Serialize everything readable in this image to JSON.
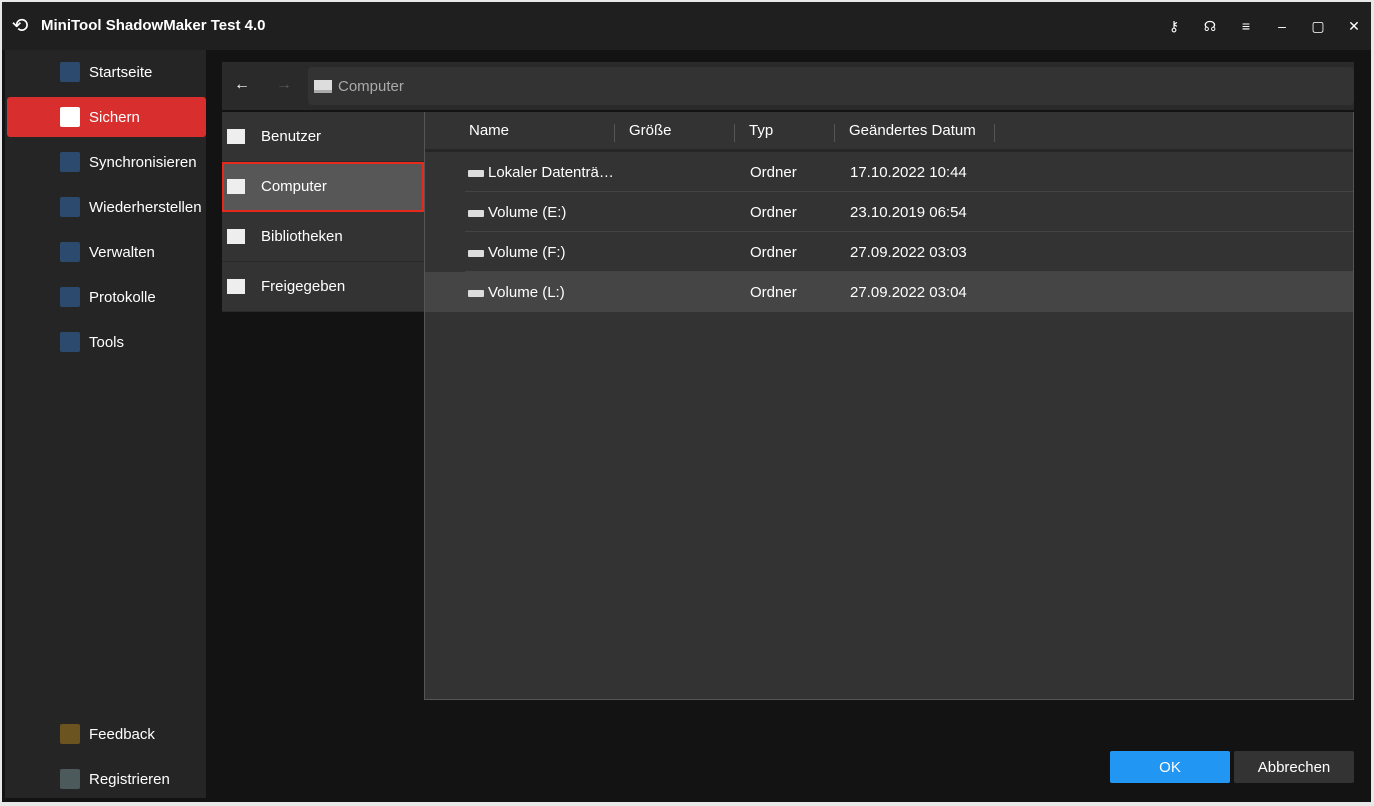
{
  "title": "MiniTool ShadowMaker Test 4.0",
  "sidebar": {
    "items": [
      {
        "label": "Startseite"
      },
      {
        "label": "Sichern"
      },
      {
        "label": "Synchronisieren"
      },
      {
        "label": "Wiederherstellen"
      },
      {
        "label": "Verwalten"
      },
      {
        "label": "Protokolle"
      },
      {
        "label": "Tools"
      }
    ],
    "feedback": "Feedback",
    "register": "Registrieren"
  },
  "nav": {
    "back": "←",
    "forward": "→",
    "path": "Computer"
  },
  "places": [
    {
      "label": "Benutzer"
    },
    {
      "label": "Computer"
    },
    {
      "label": "Bibliotheken"
    },
    {
      "label": "Freigegeben"
    }
  ],
  "columns": {
    "name": "Name",
    "size": "Größe",
    "type": "Typ",
    "date": "Geändertes Datum"
  },
  "rows": [
    {
      "name": "Lokaler Datenträ…",
      "type": "Ordner",
      "date": "17.10.2022 10:44"
    },
    {
      "name": "Volume (E:)",
      "type": "Ordner",
      "date": "23.10.2019 06:54"
    },
    {
      "name": "Volume (F:)",
      "type": "Ordner",
      "date": "27.09.2022 03:03"
    },
    {
      "name": "Volume (L:)",
      "type": "Ordner",
      "date": "27.09.2022 03:04"
    }
  ],
  "buttons": {
    "ok": "OK",
    "cancel": "Abbrechen"
  },
  "colors": {
    "accent": "#d92e2e",
    "ok": "#2196f3"
  }
}
